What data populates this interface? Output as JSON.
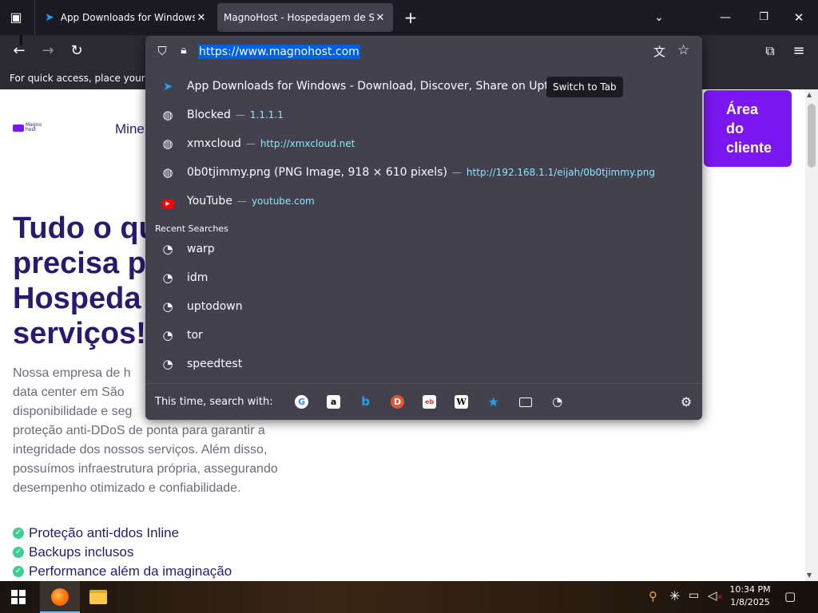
{
  "tabs": [
    {
      "title": "App Downloads for Windows - Do",
      "active": false
    },
    {
      "title": "MagnoHost - Hospedagem de Sites",
      "active": true
    }
  ],
  "toolbar": {
    "url": "https://www.magnohost.com",
    "bookmarks_hint": "For quick access, place your bookmarks here on the bookmarks toolbar."
  },
  "page": {
    "logo_text": "Magno host",
    "nav_item": "Mine",
    "hero_lines": [
      "Tudo o qu",
      "precisa p",
      "Hospeda",
      "serviços!"
    ],
    "paragraph_lines": [
      "Nossa empresa de h",
      "data center em São",
      "disponibilidade e seg",
      "proteção anti-DDoS de ponta para garantir a",
      "integridade dos nossos serviços. Além disso,",
      "possuímos infraestrutura própria, assegurando",
      "desempenho otimizado e confiabilidade."
    ],
    "features": [
      "Proteção anti-ddos Inline",
      "Backups inclusos",
      "Performance além da imaginação"
    ],
    "client_button": [
      "Área",
      "do",
      "cliente"
    ]
  },
  "dropdown": {
    "suggestions": [
      {
        "title": "App Downloads for Windows - Download, Discover, Share on Uptodown",
        "url": "",
        "icon": "uptodown-icon"
      },
      {
        "title": "Blocked",
        "url": "1.1.1.1",
        "icon": "globe-icon"
      },
      {
        "title": "xmxcloud",
        "url": "http://xmxcloud.net",
        "icon": "globe-icon"
      },
      {
        "title": "0b0tjimmy.png (PNG Image, 918 × 610 pixels)",
        "url": "http://192.168.1.1/eijah/0b0tjimmy.png",
        "icon": "globe-icon"
      },
      {
        "title": "YouTube",
        "url": "youtube.com",
        "icon": "youtube-icon"
      }
    ],
    "switch_tab": "Switch to Tab",
    "recent_label": "Recent Searches",
    "recent": [
      "warp",
      "idm",
      "uptodown",
      "tor",
      "speedtest"
    ],
    "search_with": "This time, search with:",
    "engines": [
      "google-icon",
      "amazon-icon",
      "bing-icon",
      "duckduckgo-icon",
      "ebay-icon",
      "wikipedia-icon",
      "bookmarks-icon",
      "tabs-icon",
      "history-icon"
    ]
  },
  "taskbar": {
    "time": "10:34 PM",
    "date": "1/8/2025"
  },
  "colors": {
    "accent_purple": "#7a16f0",
    "hero_text": "#2a1a6e",
    "dropdown_bg": "#42414d",
    "url_link": "#80ebff"
  }
}
